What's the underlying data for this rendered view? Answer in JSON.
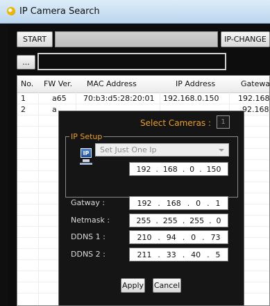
{
  "window": {
    "title": "IP Camera Search"
  },
  "toolbar": {
    "start_label": "START",
    "ip_change_label": "IP-CHANGE",
    "browse_label": "...",
    "progress": 0
  },
  "table": {
    "columns": [
      "No.",
      "FW Ver.",
      "MAC Address",
      "IP Address",
      "Gatewa"
    ],
    "rows": [
      {
        "no": "1",
        "fw": "a65",
        "mac": "70:b3:d5:28:20:01",
        "ip": "192.168.0.150",
        "gw": "192.168."
      },
      {
        "no": "2",
        "fw": "a",
        "mac": "",
        "ip": "",
        "gw": "92.168."
      }
    ]
  },
  "dialog": {
    "select_label": "Select Cameras :",
    "select_value": "1",
    "group_label": "IP Setup",
    "ip_icon_text": "IP",
    "mode_select": "Set Just One Ip",
    "ip": [
      "192",
      "168",
      "0",
      "150"
    ],
    "fields": [
      {
        "label": "Gatway :",
        "parts": [
          "192",
          "168",
          "0",
          "1"
        ]
      },
      {
        "label": "Netmask :",
        "parts": [
          "255",
          "255",
          "255",
          "0"
        ]
      },
      {
        "label": "DDNS 1 :",
        "parts": [
          "210",
          "94",
          "0",
          "73"
        ]
      },
      {
        "label": "DDNS 2 :",
        "parts": [
          "211",
          "33",
          "40",
          "5"
        ]
      }
    ],
    "apply_label": "Apply",
    "cancel_label": "Cancel"
  },
  "colors": {
    "titlebar": "#c9def2",
    "dialog_bg": "#151515",
    "accent_orange": "#e8a020",
    "select_value_color": "#8a8a8a"
  }
}
